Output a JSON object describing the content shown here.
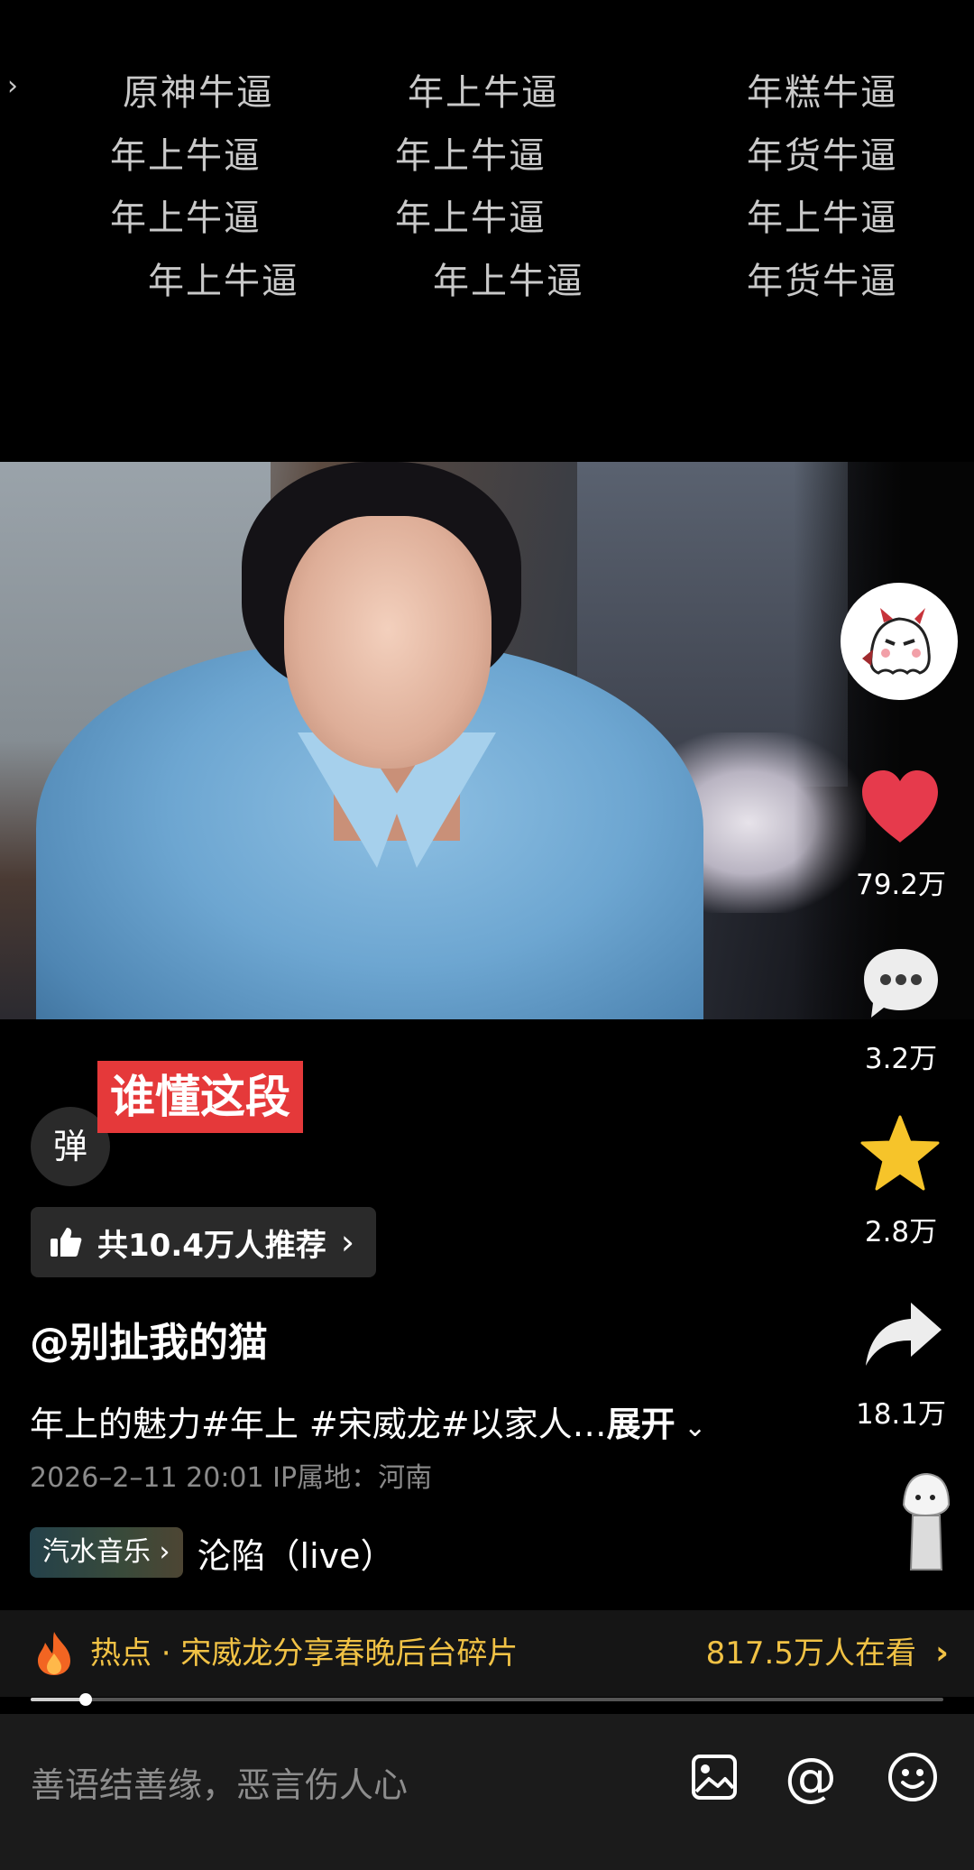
{
  "danmaku": {
    "rows": [
      [
        "原神牛逼",
        "年上牛逼",
        "年糕牛逼"
      ],
      [
        "年上牛逼",
        "年上牛逼",
        "年货牛逼"
      ],
      [
        "年上牛逼",
        "年上牛逼",
        "年上牛逼"
      ],
      [
        "年上牛逼",
        "年上牛逼",
        "年货牛逼"
      ]
    ]
  },
  "actions": {
    "like_count": "79.2万",
    "comment_count": "3.2万",
    "favorite_count": "2.8万",
    "share_count": "18.1万"
  },
  "overlay": {
    "danmu_button": "弹",
    "red_tag": "谁懂这段",
    "recommend_text": "共10.4万人推荐"
  },
  "post": {
    "author": "@别扯我的猫",
    "description": "年上的魅力#年上 #宋威龙#以家人…",
    "expand_label": "展开",
    "meta": "2026–2–11 20:01   IP属地：河南",
    "music_chip": "汽水音乐",
    "music_name": "沦陷（live）"
  },
  "hot": {
    "text": "热点 · 宋威龙分享春晚后台碎片",
    "viewers": "817.5万人在看"
  },
  "progress": {
    "fraction": 0.06
  },
  "comment": {
    "placeholder": "善语结善缘，恶言伤人心"
  },
  "colors": {
    "like": "#e63a4c",
    "star": "#f6c42a",
    "hot": "#f1c245",
    "tag": "#e5393a"
  }
}
